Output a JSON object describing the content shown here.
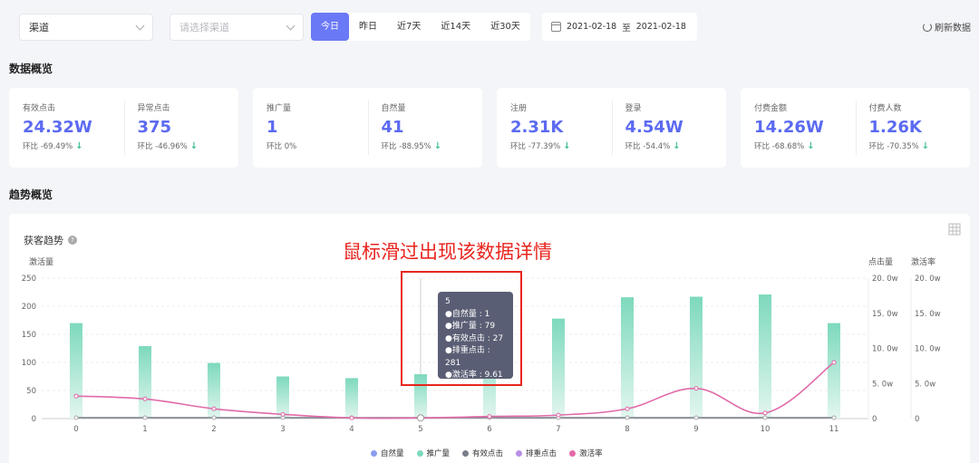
{
  "filters": {
    "channel_value": "渠道",
    "subchannel_placeholder": "请选择渠道",
    "ranges": [
      "今日",
      "昨日",
      "近7天",
      "近14天",
      "近30天"
    ],
    "active_range": 0,
    "date_start": "2021-02-18",
    "date_sep": "至",
    "date_end": "2021-02-18",
    "refresh_label": "刷新数据"
  },
  "overview": {
    "title": "数据概览",
    "cards": [
      [
        {
          "label": "有效点击",
          "value": "24.32W",
          "ratio": "环比 -69.49%",
          "down": true
        },
        {
          "label": "异常点击",
          "value": "375",
          "ratio": "环比 -46.96%",
          "down": true
        }
      ],
      [
        {
          "label": "推广量",
          "value": "1",
          "ratio": "环比 0%",
          "down": false
        },
        {
          "label": "自然量",
          "value": "41",
          "ratio": "环比 -88.95%",
          "down": true
        }
      ],
      [
        {
          "label": "注册",
          "value": "2.31K",
          "ratio": "环比 -77.39%",
          "down": true
        },
        {
          "label": "登录",
          "value": "4.54W",
          "ratio": "环比 -54.4%",
          "down": true
        }
      ],
      [
        {
          "label": "付费金额",
          "value": "14.26W",
          "ratio": "环比 -68.68%",
          "down": true
        },
        {
          "label": "付费人数",
          "value": "1.26K",
          "ratio": "环比 -70.35%",
          "down": true
        }
      ]
    ]
  },
  "trend": {
    "title": "趋势概览",
    "chart_title": "获客趋势",
    "help_icon": "?",
    "annotation": "鼠标滑过出现该数据详情",
    "tooltip": {
      "header": "5",
      "rows": [
        {
          "label": "●自然量 : 1",
          "color": "#8b9cf0"
        },
        {
          "label": "●推广量 : 79",
          "color": "#7dd9bd"
        },
        {
          "label": "●有效点击 : 27",
          "color": "#7a7d8a"
        },
        {
          "label": "●排重点击 : 281",
          "color": "#b98ee8"
        },
        {
          "label": "●激活率 : 9.61",
          "color": "#e46aa8"
        }
      ]
    }
  },
  "colors": {
    "accent": "#6a79f5",
    "value_blue": "#5b6af2",
    "bar_green": "#7dd9bd",
    "line_pink": "#e06aa8",
    "annotation_red": "#e8251f"
  },
  "chart_data": {
    "type": "bar",
    "categories": [
      "0",
      "1",
      "2",
      "3",
      "4",
      "5",
      "6",
      "7",
      "8",
      "9",
      "10",
      "11"
    ],
    "series": [
      {
        "name": "自然量",
        "type": "line",
        "axis": "left",
        "values": [
          1,
          1,
          1,
          1,
          1,
          1,
          1,
          1,
          1,
          1,
          1,
          1
        ]
      },
      {
        "name": "推广量",
        "type": "bar",
        "axis": "left",
        "values": [
          170,
          129,
          99,
          75,
          72,
          79,
          150,
          178,
          216,
          217,
          221,
          170
        ]
      },
      {
        "name": "有效点击",
        "type": "line",
        "axis": "right1",
        "values": [
          0,
          0,
          0,
          0,
          0,
          0,
          0,
          0,
          0,
          0,
          0,
          0
        ]
      },
      {
        "name": "排重点击",
        "type": "line",
        "axis": "right1",
        "values": [
          0,
          0,
          0,
          0,
          0,
          0,
          0,
          0,
          0,
          0,
          0,
          0
        ]
      },
      {
        "name": "激活率",
        "type": "line",
        "axis": "right2",
        "values": [
          3.2,
          2.8,
          1.4,
          0.6,
          0.1,
          0.1,
          0.3,
          0.5,
          1.4,
          4.3,
          0.8,
          8.0
        ]
      }
    ],
    "y_left": {
      "label": "激活量",
      "ticks": [
        "0",
        "50",
        "100",
        "150",
        "200",
        "250"
      ],
      "ylim": [
        0,
        250
      ]
    },
    "y_right1": {
      "label": "点击量",
      "ticks": [
        "0",
        "5. 0w",
        "10. 0w",
        "15. 0w",
        "20. 0w"
      ],
      "ylim": [
        0,
        20
      ]
    },
    "y_right2": {
      "label": "激活率",
      "ticks": [
        "0",
        "5. 0w",
        "10. 0w",
        "15. 0w",
        "20. 0w"
      ],
      "ylim": [
        0,
        20
      ]
    },
    "hover_index": 5,
    "grid": true,
    "legend_position": "bottom"
  }
}
